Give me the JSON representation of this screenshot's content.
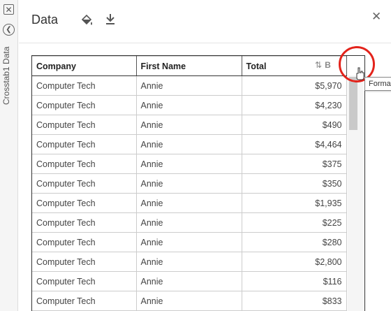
{
  "sidebar": {
    "label": "Crosstab1 Data"
  },
  "header": {
    "title": "Data"
  },
  "table": {
    "columns": [
      "Company",
      "First Name",
      "Total"
    ],
    "rows": [
      [
        "Computer Tech",
        "Annie",
        "$5,970"
      ],
      [
        "Computer Tech",
        "Annie",
        "$4,230"
      ],
      [
        "Computer Tech",
        "Annie",
        "$490"
      ],
      [
        "Computer Tech",
        "Annie",
        "$4,464"
      ],
      [
        "Computer Tech",
        "Annie",
        "$375"
      ],
      [
        "Computer Tech",
        "Annie",
        "$350"
      ],
      [
        "Computer Tech",
        "Annie",
        "$1,935"
      ],
      [
        "Computer Tech",
        "Annie",
        "$225"
      ],
      [
        "Computer Tech",
        "Annie",
        "$280"
      ],
      [
        "Computer Tech",
        "Annie",
        "$2,800"
      ],
      [
        "Computer Tech",
        "Annie",
        "$116"
      ],
      [
        "Computer Tech",
        "Annie",
        "$833"
      ]
    ]
  },
  "tooltip": {
    "text": "Format"
  },
  "colors": {
    "highlight": "#e3231b"
  }
}
